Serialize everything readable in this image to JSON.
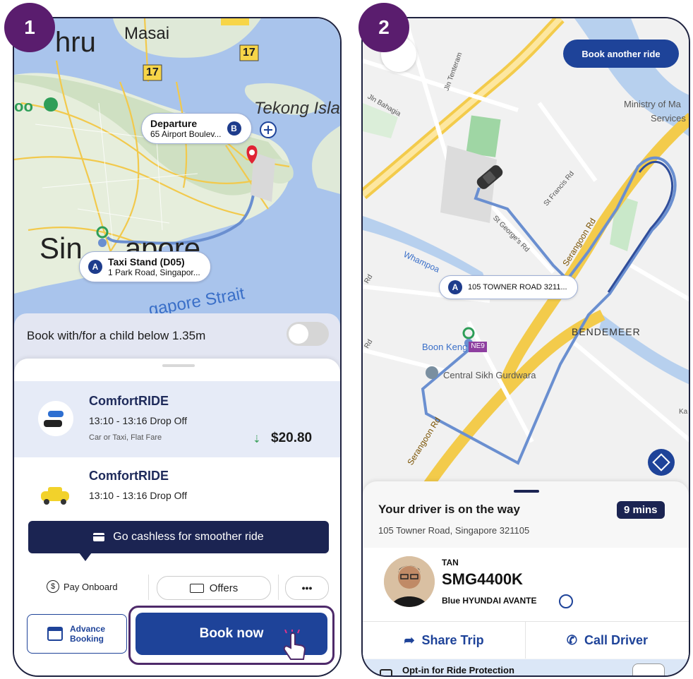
{
  "steps": {
    "one": "1",
    "two": "2"
  },
  "screen1": {
    "map_labels": {
      "johor_partial": "hru",
      "masai": "Masai",
      "route17a": "17",
      "route17b": "17",
      "tekong": "Tekong Isla",
      "singapore_partial": "Sin",
      "singapore_partial2": "apore",
      "strait_partial": "gapore Strait",
      "zoo_partial": "oo"
    },
    "departure": {
      "title": "Departure",
      "address": "65 Airport Boulev...",
      "badge": "B"
    },
    "pickup": {
      "title": "Taxi Stand (D05)",
      "address": "1 Park Road, Singapor...",
      "badge": "A"
    },
    "child_toggle_label": "Book with/for a child below 1.35m",
    "rides": [
      {
        "name": "ComfortRIDE",
        "time": "13:10 - 13:16 Drop Off",
        "desc": "Car or Taxi, Flat Fare",
        "price": "$20.80"
      },
      {
        "name": "ComfortRIDE",
        "time": "13:10 - 13:16 Drop Off"
      }
    ],
    "cashless_banner": "Go cashless for smoother ride",
    "payment": {
      "pay_label": "Pay Onboard",
      "offers_label": "Offers",
      "more_label": "•••"
    },
    "advance_booking": {
      "line1": "Advance",
      "line2": "Booking"
    },
    "book_now": "Book now"
  },
  "screen2": {
    "book_another": "Book another ride",
    "map_labels": {
      "jln_tenteram": "Jln Tenteram",
      "jln_bahagia": "Jln Bahagia",
      "st_francis": "St Francis Rd",
      "st_georges": "St George's Rd",
      "serangoon_rd": "Serangoon Rd",
      "serangoon_rd2": "Serangoon Rd",
      "whampoa": "Whampoa",
      "ministry": "Ministry of Ma",
      "services": "Services",
      "bendemeer": "BENDEMEER",
      "boon_keng": "Boon Keng",
      "ne9": "NE9",
      "gurdwara": "Central Sikh Gurdwara",
      "ka": "Ka",
      "rd_left": "Rd",
      "rd_left2": "Rd"
    },
    "pickup_label": "105 TOWNER ROAD 3211...",
    "pickup_badge": "A",
    "status": "Your driver is on the way",
    "eta": "9 mins",
    "address": "105 Towner Road, Singapore 321105",
    "driver": {
      "name": "TAN",
      "plate": "SMG4400K",
      "car": "Blue HYUNDAI AVANTE"
    },
    "share_trip": "Share Trip",
    "call_driver": "Call Driver",
    "ride_protection": "Opt-in for Ride Protection"
  }
}
